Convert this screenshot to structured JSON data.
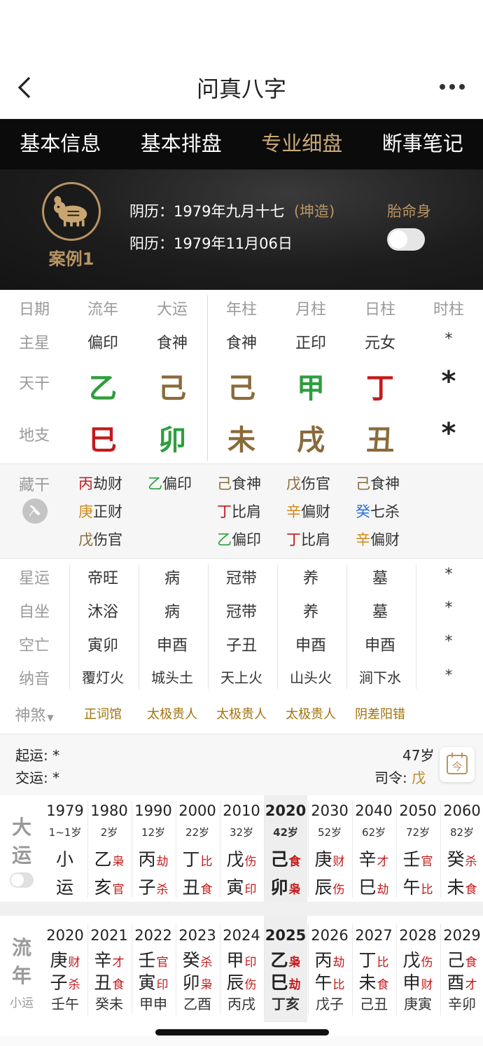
{
  "nav": {
    "title": "问真八字"
  },
  "tabs": [
    "基本信息",
    "基本排盘",
    "专业细盘",
    "断事笔记"
  ],
  "active_tab": 2,
  "hero": {
    "case_label": "案例1",
    "lunar_label": "阴历：",
    "lunar_date": "1979年九月十七",
    "gender": "(坤造)",
    "solar_label": "阳历：",
    "solar_date": "1979年11月06日",
    "taiming_label": "胎命身"
  },
  "grid": {
    "headers": [
      "日期",
      "流年",
      "大运",
      "年柱",
      "月柱",
      "日柱",
      "时柱"
    ],
    "rows": [
      {
        "label": "主星",
        "cells": [
          "偏印",
          "食神",
          "食神",
          "正印",
          "元女",
          "*"
        ]
      },
      {
        "label": "天干",
        "cells": [
          {
            "t": "乙",
            "c": "#2e9e3e"
          },
          {
            "t": "己",
            "c": "#8a6a3a"
          },
          {
            "t": "己",
            "c": "#8a6a3a"
          },
          {
            "t": "甲",
            "c": "#2e9e3e"
          },
          {
            "t": "丁",
            "c": "#c41a1a"
          },
          {
            "t": "*",
            "c": "#222"
          }
        ]
      },
      {
        "label": "地支",
        "cells": [
          {
            "t": "巳",
            "c": "#c41a1a"
          },
          {
            "t": "卯",
            "c": "#2e9e3e"
          },
          {
            "t": "未",
            "c": "#8a6a3a"
          },
          {
            "t": "戌",
            "c": "#8a6a3a"
          },
          {
            "t": "丑",
            "c": "#8a6a3a"
          },
          {
            "t": "*",
            "c": "#222"
          }
        ]
      }
    ]
  },
  "hidden_stems": {
    "label": "藏干",
    "cols": [
      [
        {
          "g": "丙",
          "gc": "#c41a1a",
          "s": "劫财"
        },
        {
          "g": "庚",
          "gc": "#d08a1a",
          "s": "正财"
        },
        {
          "g": "戊",
          "gc": "#8a6a3a",
          "s": "伤官"
        }
      ],
      [
        {
          "g": "乙",
          "gc": "#2e9e3e",
          "s": "偏印"
        }
      ],
      [
        {
          "g": "己",
          "gc": "#8a6a3a",
          "s": "食神"
        },
        {
          "g": "丁",
          "gc": "#c41a1a",
          "s": "比肩"
        },
        {
          "g": "乙",
          "gc": "#2e9e3e",
          "s": "偏印"
        }
      ],
      [
        {
          "g": "戊",
          "gc": "#8a6a3a",
          "s": "伤官"
        },
        {
          "g": "辛",
          "gc": "#d08a1a",
          "s": "偏财"
        },
        {
          "g": "丁",
          "gc": "#c41a1a",
          "s": "比肩"
        }
      ],
      [
        {
          "g": "己",
          "gc": "#8a6a3a",
          "s": "食神"
        },
        {
          "g": "癸",
          "gc": "#2a6fd6",
          "s": "七杀"
        },
        {
          "g": "辛",
          "gc": "#d08a1a",
          "s": "偏财"
        }
      ]
    ]
  },
  "details": [
    {
      "label": "星运",
      "cells": [
        "帝旺",
        "病",
        "冠带",
        "养",
        "墓",
        "*"
      ]
    },
    {
      "label": "自坐",
      "cells": [
        "沐浴",
        "病",
        "冠带",
        "养",
        "墓",
        "*"
      ]
    },
    {
      "label": "空亡",
      "cells": [
        "寅卯",
        "申酉",
        "子丑",
        "申酉",
        "申酉",
        "*"
      ]
    },
    {
      "label": "纳音",
      "cells": [
        "覆灯火",
        "城头土",
        "天上火",
        "山头火",
        "涧下水",
        "*"
      ]
    }
  ],
  "shensha": {
    "label": "神煞",
    "cells": [
      "正词馆",
      "太极贵人",
      "太极贵人",
      "太极贵人",
      "阴差阳错"
    ]
  },
  "bar": {
    "qiyun": "起运: *",
    "jiaoyun": "交运: *",
    "age": "47岁",
    "siling_label": "司令: ",
    "siling": "戊"
  },
  "dayun": {
    "side": [
      "大",
      "运"
    ],
    "cols": [
      {
        "year": "1979",
        "age": "1~1岁",
        "a": "小",
        "as": "",
        "asc": "",
        "b": "运",
        "bs": "",
        "bsc": ""
      },
      {
        "year": "1980",
        "age": "2岁",
        "a": "乙",
        "as": "枭",
        "asc": "#c41a1a",
        "b": "亥",
        "bs": "官",
        "bsc": "#c41a1a"
      },
      {
        "year": "1990",
        "age": "12岁",
        "a": "丙",
        "as": "劫",
        "asc": "#c41a1a",
        "b": "子",
        "bs": "杀",
        "bsc": "#c41a1a"
      },
      {
        "year": "2000",
        "age": "22岁",
        "a": "丁",
        "as": "比",
        "asc": "#c41a1a",
        "b": "丑",
        "bs": "食",
        "bsc": "#c41a1a"
      },
      {
        "year": "2010",
        "age": "32岁",
        "a": "戊",
        "as": "伤",
        "asc": "#c41a1a",
        "b": "寅",
        "bs": "印",
        "bsc": "#c41a1a"
      },
      {
        "year": "2020",
        "age": "42岁",
        "a": "己",
        "as": "食",
        "asc": "#c41a1a",
        "b": "卯",
        "bs": "枭",
        "bsc": "#c41a1a",
        "active": true
      },
      {
        "year": "2030",
        "age": "52岁",
        "a": "庚",
        "as": "财",
        "asc": "#c41a1a",
        "b": "辰",
        "bs": "伤",
        "bsc": "#c41a1a"
      },
      {
        "year": "2040",
        "age": "62岁",
        "a": "辛",
        "as": "才",
        "asc": "#c41a1a",
        "b": "巳",
        "bs": "劫",
        "bsc": "#c41a1a"
      },
      {
        "year": "2050",
        "age": "72岁",
        "a": "壬",
        "as": "官",
        "asc": "#c41a1a",
        "b": "午",
        "bs": "比",
        "bsc": "#c41a1a"
      },
      {
        "year": "2060",
        "age": "82岁",
        "a": "癸",
        "as": "杀",
        "asc": "#c41a1a",
        "b": "未",
        "bs": "食",
        "bsc": "#c41a1a"
      }
    ]
  },
  "liunian": {
    "side": [
      "流",
      "年"
    ],
    "side_small": "小运",
    "cols": [
      {
        "year": "2020",
        "a": "庚",
        "as": "财",
        "b": "子",
        "bs": "杀",
        "x": "壬午"
      },
      {
        "year": "2021",
        "a": "辛",
        "as": "才",
        "b": "丑",
        "bs": "食",
        "x": "癸未"
      },
      {
        "year": "2022",
        "a": "壬",
        "as": "官",
        "b": "寅",
        "bs": "印",
        "x": "甲申"
      },
      {
        "year": "2023",
        "a": "癸",
        "as": "杀",
        "b": "卯",
        "bs": "枭",
        "x": "乙酉"
      },
      {
        "year": "2024",
        "a": "甲",
        "as": "印",
        "b": "辰",
        "bs": "伤",
        "x": "丙戌"
      },
      {
        "year": "2025",
        "a": "乙",
        "as": "枭",
        "b": "巳",
        "bs": "劫",
        "x": "丁亥",
        "active": true
      },
      {
        "year": "2026",
        "a": "丙",
        "as": "劫",
        "b": "午",
        "bs": "比",
        "x": "戊子"
      },
      {
        "year": "2027",
        "a": "丁",
        "as": "比",
        "b": "未",
        "bs": "食",
        "x": "己丑"
      },
      {
        "year": "2028",
        "a": "戊",
        "as": "伤",
        "b": "申",
        "bs": "财",
        "x": "庚寅"
      },
      {
        "year": "2029",
        "a": "己",
        "as": "食",
        "b": "酉",
        "bs": "才",
        "x": "辛卯"
      }
    ]
  }
}
